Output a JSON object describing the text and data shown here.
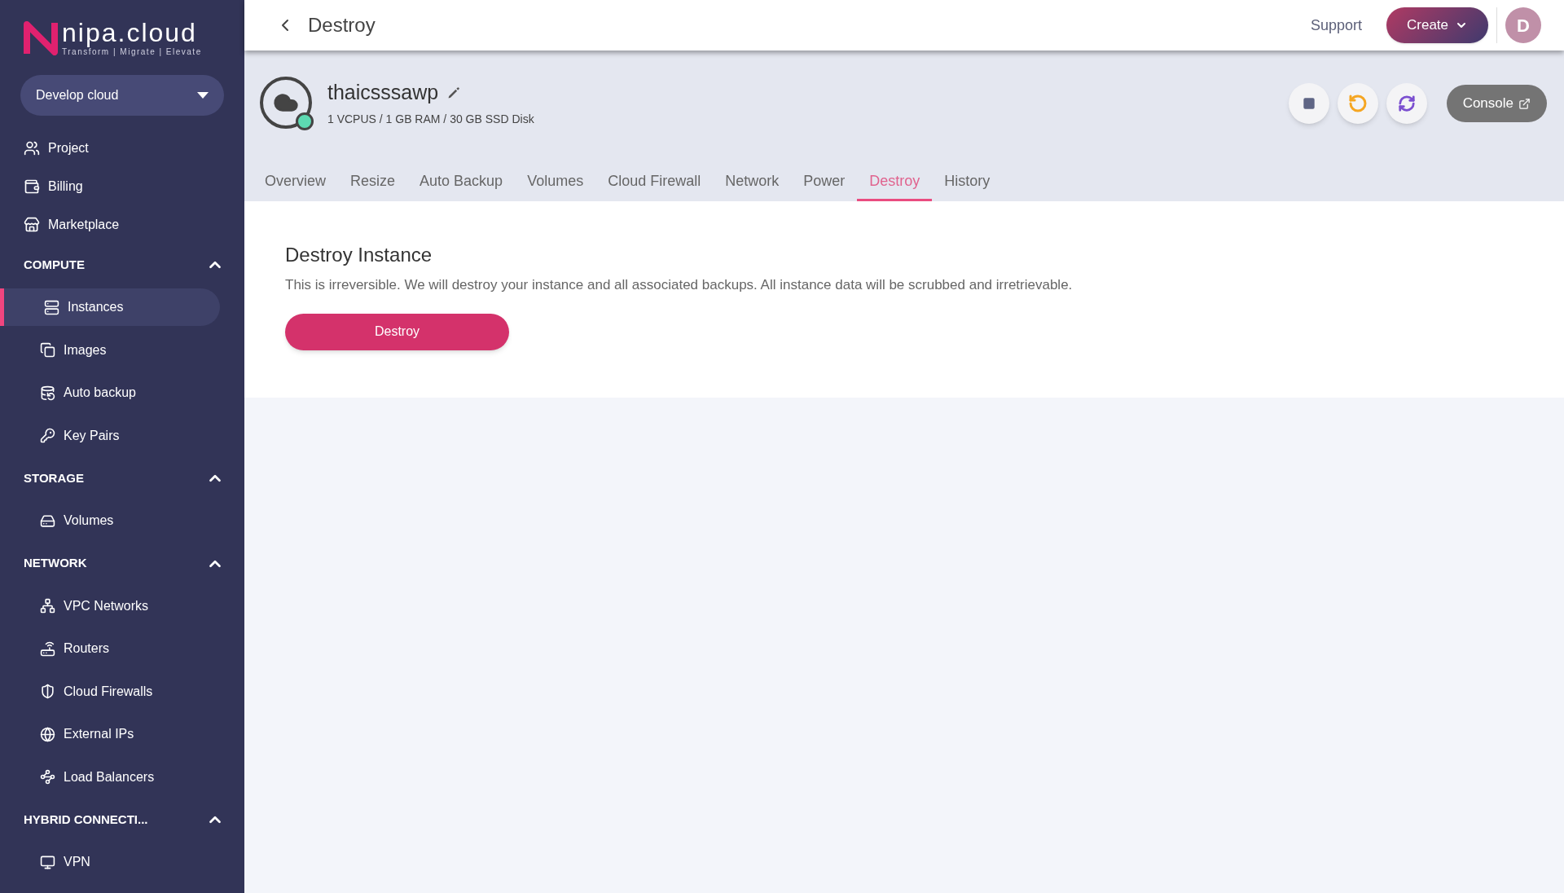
{
  "sidebar": {
    "logo": {
      "text": "nipa.cloud",
      "tagline": "Transform | Migrate | Elevate"
    },
    "project_selector": {
      "value": "Develop cloud"
    },
    "items": [
      {
        "label": "Project",
        "selected": false
      },
      {
        "label": "Billing",
        "selected": false
      },
      {
        "label": "Marketplace",
        "selected": false
      }
    ],
    "sections": [
      {
        "title": "COMPUTE",
        "expanded": true,
        "items": [
          {
            "label": "Instances",
            "selected": true
          },
          {
            "label": "Images",
            "selected": false
          },
          {
            "label": "Auto backup",
            "selected": false
          },
          {
            "label": "Key Pairs",
            "selected": false
          }
        ]
      },
      {
        "title": "STORAGE",
        "expanded": true,
        "items": [
          {
            "label": "Volumes",
            "selected": false
          }
        ]
      },
      {
        "title": "NETWORK",
        "expanded": true,
        "items": [
          {
            "label": "VPC Networks",
            "selected": false
          },
          {
            "label": "Routers",
            "selected": false
          },
          {
            "label": "Cloud Firewalls",
            "selected": false
          },
          {
            "label": "External IPs",
            "selected": false
          },
          {
            "label": "Load Balancers",
            "selected": false
          }
        ]
      },
      {
        "title": "HYBRID CONNECTI...",
        "expanded": true,
        "items": [
          {
            "label": "VPN",
            "selected": false
          }
        ]
      }
    ]
  },
  "topbar": {
    "title": "Destroy",
    "support": "Support",
    "create": "Create",
    "avatar": "D"
  },
  "instance": {
    "name": "thaicsssawp",
    "specs": "1 VCPUS / 1 GB RAM / 30 GB SSD Disk",
    "online": true,
    "console": "Console"
  },
  "tabs": [
    {
      "label": "Overview",
      "selected": false
    },
    {
      "label": "Resize",
      "selected": false
    },
    {
      "label": "Auto Backup",
      "selected": false
    },
    {
      "label": "Volumes",
      "selected": false
    },
    {
      "label": "Cloud Firewall",
      "selected": false
    },
    {
      "label": "Network",
      "selected": false
    },
    {
      "label": "Power",
      "selected": false
    },
    {
      "label": "Destroy",
      "selected": true
    },
    {
      "label": "History",
      "selected": false
    }
  ],
  "panel": {
    "title": "Destroy Instance",
    "description": "This is irreversible. We will destroy your instance and all associated backups. All instance data will be scrubbed and irretrievable.",
    "button": "Destroy"
  }
}
